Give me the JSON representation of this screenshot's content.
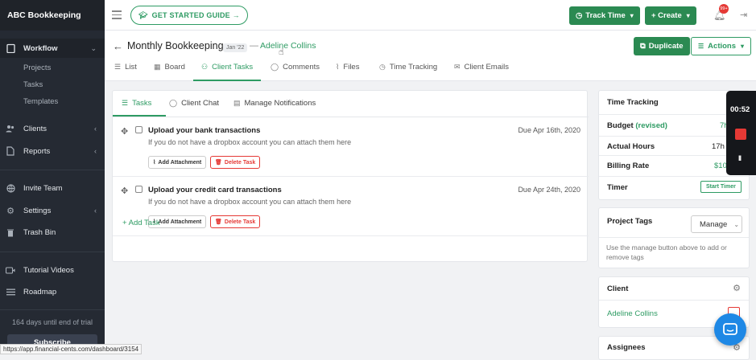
{
  "brand": "ABC Bookkeeping",
  "sidebar": {
    "items": [
      {
        "label": "Workflow",
        "icon": "clipboard-icon"
      },
      {
        "label": "Clients",
        "icon": "users-icon"
      },
      {
        "label": "Reports",
        "icon": "file-icon"
      },
      {
        "label": "Invite Team",
        "icon": "globe-icon"
      },
      {
        "label": "Settings",
        "icon": "gear-icon"
      },
      {
        "label": "Trash Bin",
        "icon": "trash-icon"
      },
      {
        "label": "Tutorial Videos",
        "icon": "video-icon"
      },
      {
        "label": "Roadmap",
        "icon": "list-icon"
      }
    ],
    "workflow_sub": [
      "Projects",
      "Tasks",
      "Templates"
    ],
    "trial_text": "164 days until end of trial",
    "subscribe_label": "Subscribe"
  },
  "status_url": "https://app.financial-cents.com/dashboard/3154",
  "topbar": {
    "get_started": "GET STARTED GUIDE →",
    "track_time": "Track Time",
    "create": "+ Create",
    "notif_count": "99+"
  },
  "header": {
    "title": "Monthly Bookkeeping",
    "period": "Jan '22",
    "dash": "—",
    "client": "Adeline Collins",
    "duplicate": "Duplicate",
    "actions": "Actions",
    "tabs": [
      {
        "label": "List",
        "icon": "list-icon"
      },
      {
        "label": "Board",
        "icon": "board-icon"
      },
      {
        "label": "Client Tasks",
        "icon": "user-icon"
      },
      {
        "label": "Comments",
        "icon": "comment-icon"
      },
      {
        "label": "Files",
        "icon": "paperclip-icon"
      },
      {
        "label": "Time Tracking",
        "icon": "clock-icon"
      },
      {
        "label": "Client Emails",
        "icon": "mail-icon"
      }
    ]
  },
  "tasks_panel": {
    "tabs": [
      "Tasks",
      "Client Chat",
      "Manage Notifications"
    ],
    "tasks": [
      {
        "title": "Upload your bank transactions",
        "desc": "If you do not have a dropbox account you can attach them here",
        "due": "Due Apr 16th, 2020"
      },
      {
        "title": "Upload your credit card transactions",
        "desc": "If you do not have a dropbox account you can attach them here",
        "due": "Due Apr 24th, 2020"
      }
    ],
    "add_attachment": "Add Attachment",
    "delete_task": "Delete Task",
    "add_task": "+ Add Task"
  },
  "time_tracking": {
    "title": "Time Tracking",
    "budget_label": "Budget",
    "budget_tag": "(revised)",
    "budget_value": "7h",
    "actual_label": "Actual Hours",
    "actual_value": "17h",
    "rate_label": "Billing Rate",
    "rate_value": "$10",
    "timer_label": "Timer",
    "start_timer": "Start Timer"
  },
  "project_tags": {
    "title": "Project Tags",
    "manage": "Manage",
    "hint": "Use the manage button above to add or remove tags"
  },
  "client_card": {
    "title": "Client",
    "name": "Adeline Collins"
  },
  "assignees": {
    "title": "Assignees"
  },
  "timer_widget": {
    "time": "00:52",
    "pause": "II"
  },
  "colors": {
    "accent": "#2e9b63",
    "sidebar": "#252a33",
    "danger": "#e53935",
    "chat": "#1e88e5"
  }
}
